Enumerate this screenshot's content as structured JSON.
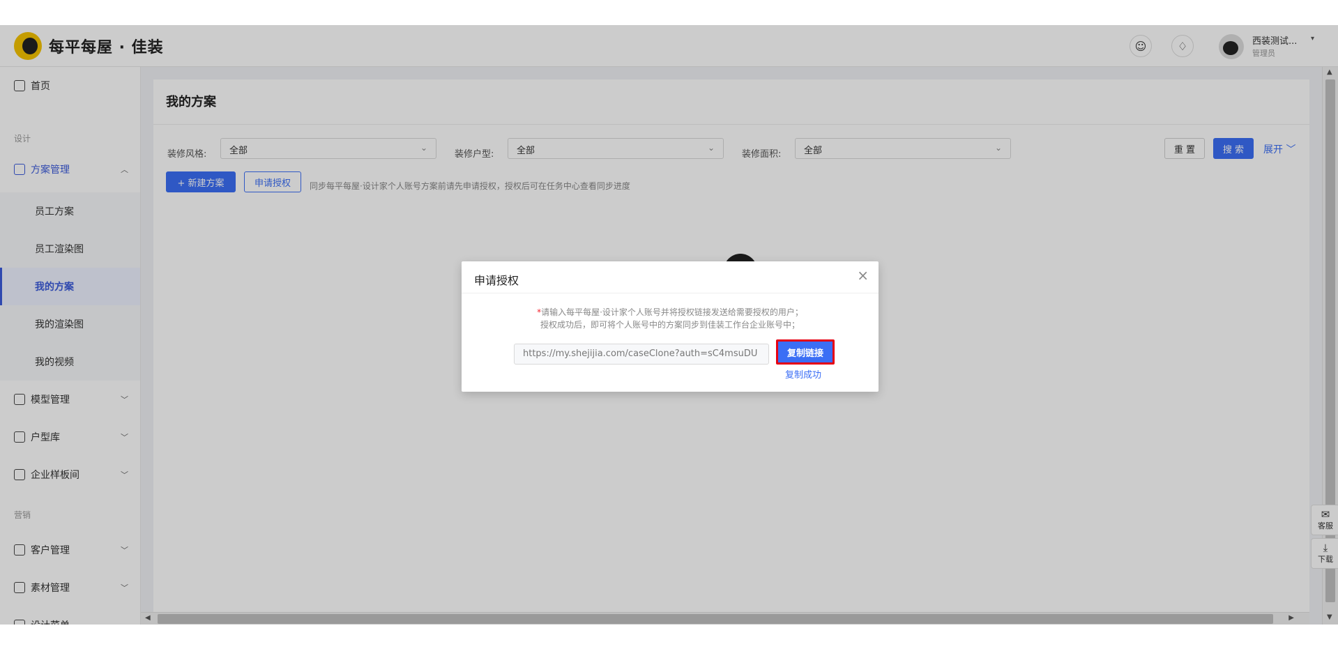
{
  "app": {
    "brand": "每平每屋 · 佳装"
  },
  "topbar": {
    "user_name": "西装测试...",
    "user_role": "管理员",
    "caret": "▾",
    "inbox_icon": "☺",
    "bell_icon": "♢"
  },
  "sidebar": {
    "home": "首页",
    "group_design": "设计",
    "plan_mgmt": "方案管理",
    "sub_items": [
      "员工方案",
      "员工渲染图",
      "我的方案",
      "我的渲染图",
      "我的视频"
    ],
    "model_mgmt": "模型管理",
    "floorplan_lib": "户型库",
    "sample_room": "企业样板间",
    "group_marketing": "营销",
    "customer_mgmt": "客户管理",
    "material_mgmt": "素材管理",
    "design_list": "设计菜单",
    "chev_up": "︿",
    "chev_down": "﹀"
  },
  "main": {
    "title": "我的方案",
    "filters": [
      {
        "label": "装修风格:",
        "value": "全部"
      },
      {
        "label": "装修户型:",
        "value": "全部"
      },
      {
        "label": "装修面积:",
        "value": "全部"
      }
    ],
    "reset_label": "重 置",
    "search_label": "搜 索",
    "expand_label": "展开 ﹀",
    "new_plan_label": "+ 新建方案",
    "apply_auth_label": "申请授权",
    "hint": "同步每平每屋·设计家个人账号方案前请先申请授权，授权后可在任务中心查看同步进度"
  },
  "float": {
    "service_icon": "✉",
    "service_label": "客服",
    "download_icon": "⤓",
    "download_label": "下载"
  },
  "modal": {
    "title": "申请授权",
    "close": "×",
    "desc_star": "*",
    "desc1": "请输入每平每屋·设计家个人账号并将授权链接发送给需要授权的用户；",
    "desc2": "授权成功后，即可将个人账号中的方案同步到佳装工作台企业账号中；",
    "link_value": "https://my.shejijia.com/caseClone?auth=sC4msuDU",
    "copy_label": "复制链接",
    "copy_success": "复制成功"
  },
  "colors": {
    "primary": "#3b6ef5",
    "highlight_border": "#e60012",
    "required_star": "#f5222d"
  }
}
